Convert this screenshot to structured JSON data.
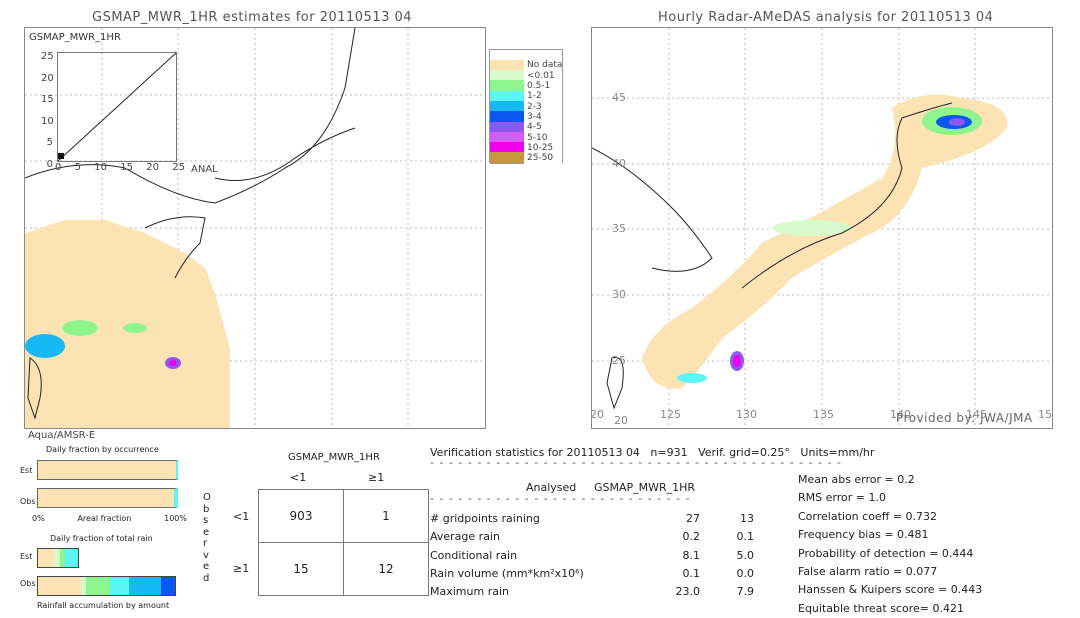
{
  "left_map": {
    "title": "GSMAP_MWR_1HR estimates for 20110513 04",
    "inset_ylabel": "GSMAP_MWR_1HR",
    "inset_xlabel": "ANAL",
    "inset_yticks": [
      "25",
      "20",
      "15",
      "10",
      "5",
      "0"
    ],
    "inset_xticks": [
      "0",
      "5",
      "10",
      "15",
      "20",
      "25"
    ],
    "sensor": "Aqua/AMSR-E"
  },
  "right_map": {
    "title": "Hourly Radar-AMeDAS analysis for 20110513 04",
    "lon_ticks": [
      "20",
      "125",
      "130",
      "135",
      "140",
      "145",
      "15"
    ],
    "lat_ticks": [
      "45",
      "40",
      "35",
      "30",
      "25",
      "20"
    ],
    "credit": "Provided by: JWA/JMA"
  },
  "legend": [
    {
      "label": "",
      "color": "#ffffff"
    },
    {
      "label": "No data",
      "color": "#fce3b4"
    },
    {
      "label": "<0.01",
      "color": "#d8fbcc"
    },
    {
      "label": "0.5-1",
      "color": "#8ef58e"
    },
    {
      "label": "1-2",
      "color": "#5cf6f6"
    },
    {
      "label": "2-3",
      "color": "#18b8f4"
    },
    {
      "label": "3-4",
      "color": "#0a58f0"
    },
    {
      "label": "4-5",
      "color": "#8a5af0"
    },
    {
      "label": "5-10",
      "color": "#d45ef4"
    },
    {
      "label": "10-25",
      "color": "#f000e8"
    },
    {
      "label": "25-50",
      "color": "#c8963c"
    }
  ],
  "fraction": {
    "occ_title": "Daily fraction by occurrence",
    "est": "Est",
    "obs": "Obs",
    "x0": "0%",
    "xmid": "Areal fraction",
    "x1": "100%",
    "rain_title": "Daily fraction of total rain",
    "rain_footer": "Rainfall accumulation by amount"
  },
  "contingency": {
    "title": "GSMAP_MWR_1HR",
    "cols": [
      "<1",
      "≥1"
    ],
    "rows": [
      "<1",
      "≥1"
    ],
    "side_label": "Observed",
    "cells": [
      [
        "903",
        "1"
      ],
      [
        "15",
        "12"
      ]
    ]
  },
  "stats": {
    "header": "Verification statistics for 20110513 04   n=931   Verif. grid=0.25°   Units=mm/hr",
    "col1": "Analysed",
    "col2": "GSMAP_MWR_1HR",
    "rows": [
      {
        "label": "# gridpoints raining",
        "a": "27",
        "b": "13"
      },
      {
        "label": "Average rain",
        "a": "0.2",
        "b": "0.1"
      },
      {
        "label": "Conditional rain",
        "a": "8.1",
        "b": "5.0"
      },
      {
        "label": "Rain volume (mm*km²x10⁶)",
        "a": "0.1",
        "b": "0.0"
      },
      {
        "label": "Maximum rain",
        "a": "23.0",
        "b": "7.9"
      }
    ],
    "scores": [
      "Mean abs error = 0.2",
      "RMS error = 1.0",
      "Correlation coeff = 0.732",
      "Frequency bias = 0.481",
      "Probability of detection = 0.444",
      "False alarm ratio = 0.077",
      "Hanssen & Kuipers score = 0.443",
      "Equitable threat score= 0.421"
    ]
  }
}
